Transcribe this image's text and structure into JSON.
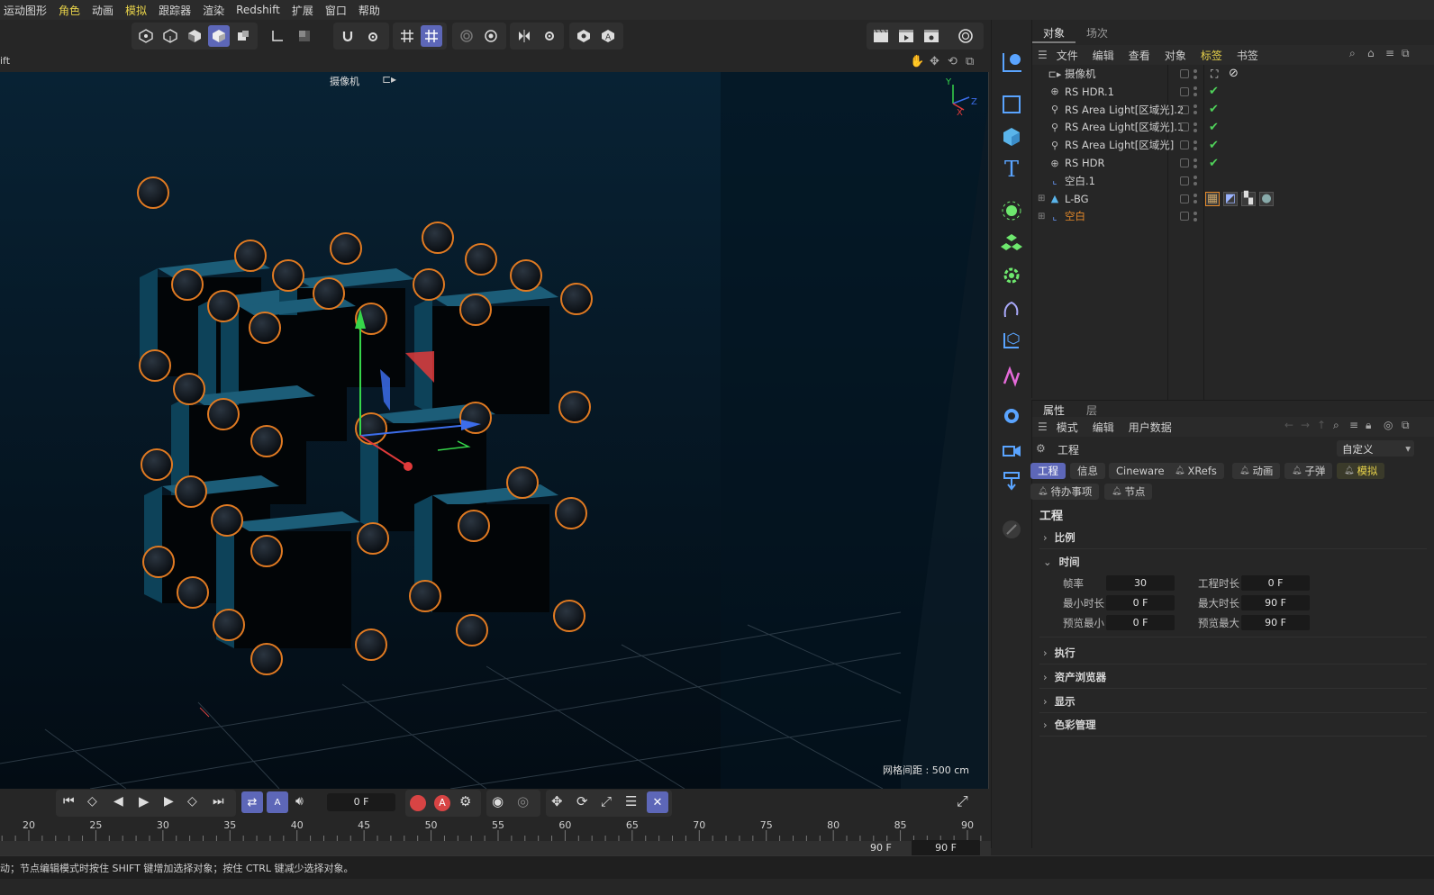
{
  "menu": [
    "运动图形",
    "角色",
    "动画",
    "模拟",
    "跟踪器",
    "渲染",
    "Redshift",
    "扩展",
    "窗口",
    "帮助"
  ],
  "menu_highlight": [
    "角色",
    "模拟"
  ],
  "viewport": {
    "left_label": "ift",
    "camera_label": "摄像机",
    "grid_spacing": "网格间距 : 500 cm",
    "axis_y": "Y",
    "axis_x": "X",
    "axis_z": "Z"
  },
  "objects": {
    "tabs": [
      "对象",
      "场次"
    ],
    "menu": [
      "文件",
      "编辑",
      "查看",
      "对象",
      "标签",
      "书签"
    ],
    "active_menu": "标签",
    "rows": [
      {
        "name": "摄像机",
        "icon": "camera-icon",
        "check": false,
        "orange": false
      },
      {
        "name": "RS HDR.1",
        "icon": "globe-icon",
        "check": true,
        "orange": false
      },
      {
        "name": "RS Area Light[区域光].2",
        "icon": "area-light-icon",
        "check": true,
        "orange": false
      },
      {
        "name": "RS Area Light[区域光].1",
        "icon": "area-light-icon",
        "check": true,
        "orange": false
      },
      {
        "name": "RS Area Light[区域光]",
        "icon": "area-light-icon",
        "check": true,
        "orange": false
      },
      {
        "name": "RS HDR",
        "icon": "globe-icon",
        "check": true,
        "orange": false
      },
      {
        "name": "空白.1",
        "icon": "null-icon",
        "check": false,
        "orange": false
      },
      {
        "name": "L-BG",
        "icon": "lbg-icon",
        "check": false,
        "orange": false
      },
      {
        "name": "空白",
        "icon": "null-icon",
        "check": false,
        "orange": true
      }
    ]
  },
  "attributes": {
    "tabs": [
      "属性",
      "层"
    ],
    "menu": [
      "模式",
      "编辑",
      "用户数据"
    ],
    "object_label": "工程",
    "preset": "自定义",
    "pills_row1": [
      "工程",
      "信息",
      "Cineware",
      "XRefs",
      "动画",
      "子弹",
      "模拟"
    ],
    "pills_row2": [
      "待办事项",
      "节点"
    ],
    "section_title": "工程",
    "groups": {
      "scale": "比例",
      "time": "时间",
      "exec": "执行",
      "asset": "资产浏览器",
      "display": "显示",
      "color": "色彩管理"
    },
    "fields": {
      "fps_label": "帧率",
      "fps": "30",
      "duration_label": "工程时长",
      "duration": "0 F",
      "min_label": "最小时长",
      "min": "0 F",
      "max_label": "最大时长",
      "max": "90 F",
      "pmin_label": "预览最小",
      "pmin": "0 F",
      "pmax_label": "预览最大",
      "pmax": "90 F"
    }
  },
  "timeline": {
    "current_frame": "0 F",
    "ticks": [
      "20",
      "25",
      "30",
      "35",
      "40",
      "45",
      "50",
      "55",
      "60",
      "65",
      "70",
      "75",
      "80",
      "85",
      "90"
    ],
    "end_frame": "90 F",
    "end_frame2": "90 F"
  },
  "status": "动；节点编辑模式时按住 SHIFT 键增加选择对象；按住 CTRL 键减少选择对象。",
  "colors": {
    "accent": "#5d67b8",
    "orange": "#e58a2a",
    "check": "#4fd25a",
    "menu_hl": "#e8d34a"
  }
}
